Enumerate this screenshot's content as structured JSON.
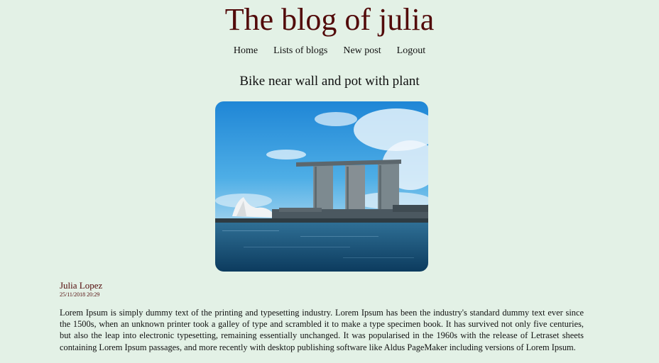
{
  "site": {
    "title": "The blog of julia"
  },
  "nav": {
    "items": [
      {
        "label": "Home"
      },
      {
        "label": "Lists of blogs"
      },
      {
        "label": "New post"
      },
      {
        "label": "Logout"
      }
    ]
  },
  "post": {
    "title": "Bike near wall and pot with plant",
    "author": "Julia Lopez",
    "date": "25/11/2018 20:29",
    "body": "Lorem Ipsum is simply dummy text of the printing and typesetting industry. Lorem Ipsum has been the industry's standard dummy text ever since the 1500s, when an unknown printer took a galley of type and scrambled it to make a type specimen book. It has survived not only five centuries, but also the leap into electronic typesetting, remaining essentially unchanged. It was popularised in the 1960s with the release of Letraset sheets containing Lorem Ipsum passages, and more recently with desktop publishing software like Aldus PageMaker including versions of Lorem Ipsum."
  },
  "colors": {
    "background": "#e3f1e6",
    "accent": "#520a0a"
  }
}
